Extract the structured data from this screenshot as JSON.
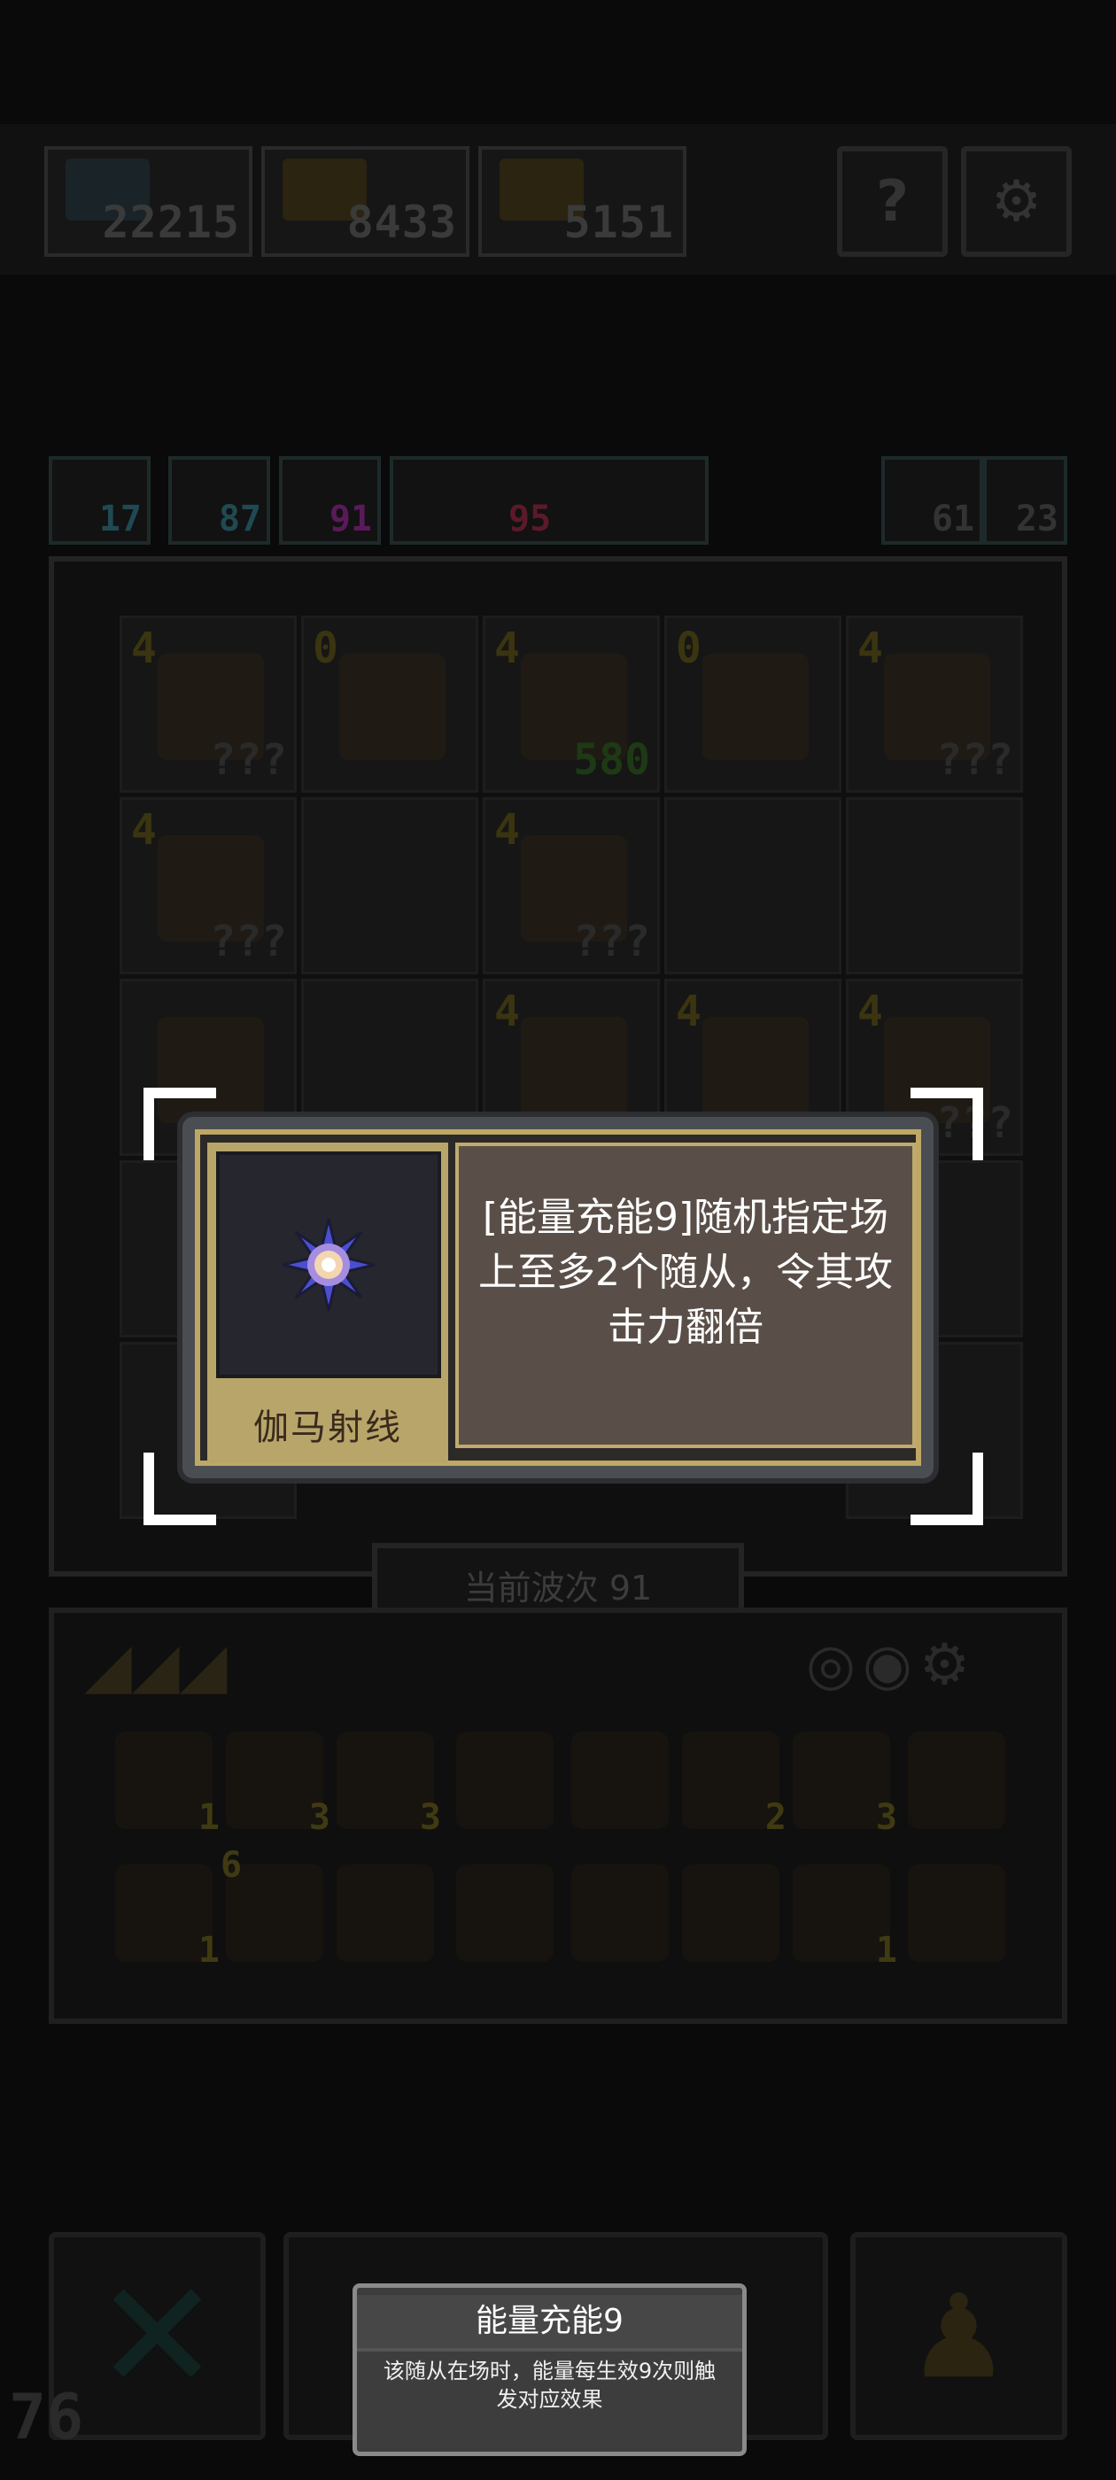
{
  "top_resources": [
    {
      "value": "22215"
    },
    {
      "value": "8433"
    },
    {
      "value": "5151"
    }
  ],
  "top_buttons": [
    {
      "icon": "question-icon",
      "glyph": "?"
    },
    {
      "icon": "settings-icon",
      "glyph": "⚙"
    }
  ],
  "stats": [
    {
      "value": "17",
      "color": "#1f4a52"
    },
    {
      "value": "87",
      "color": "#1f4a52"
    },
    {
      "value": "91",
      "color": "#5a1a5a"
    },
    {
      "value": "95",
      "color": "#5a1a2a"
    }
  ],
  "side_stats": [
    {
      "value": "61"
    },
    {
      "value": "23"
    }
  ],
  "board_cells": [
    {
      "level": "4",
      "hp": "???"
    },
    {
      "level": "0",
      "hp": ""
    },
    {
      "level": "4",
      "hp": "580"
    },
    {
      "level": "0",
      "hp": ""
    },
    {
      "level": "4",
      "hp": "???"
    },
    {
      "level": "4",
      "hp": "???"
    },
    {
      "level": "",
      "hp": ""
    },
    {
      "level": "4",
      "hp": "???"
    },
    {
      "level": "",
      "hp": ""
    },
    {
      "level": "",
      "hp": ""
    },
    {
      "level": "",
      "hp": ""
    },
    {
      "level": "",
      "hp": ""
    },
    {
      "level": "4",
      "hp": ""
    },
    {
      "level": "4",
      "hp": ""
    },
    {
      "level": "4",
      "hp": "???"
    }
  ],
  "wave": {
    "label": "当前波次 91"
  },
  "inventory_counts": [
    "1",
    "3",
    "3",
    "",
    "",
    "2",
    "3",
    "",
    "1",
    "6",
    "",
    "",
    "",
    "",
    "1",
    ""
  ],
  "card": {
    "name": "伽马射线",
    "description": "[能量充能9]随机指定场上至多2个随从，令其攻击力翻倍"
  },
  "tooltip": {
    "title": "能量充能9",
    "body": "该随从在场时，能量每生效9次则触发对应效果"
  },
  "bottom": {
    "level": "76"
  }
}
